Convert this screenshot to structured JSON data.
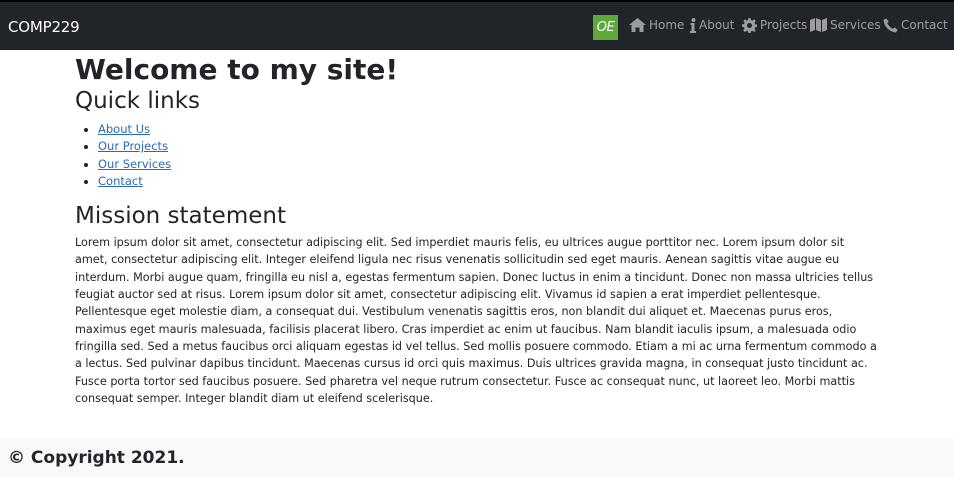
{
  "navbar": {
    "brand": "COMP229",
    "logo_text": "OE",
    "links": [
      {
        "label": "Home",
        "icon": "home-icon"
      },
      {
        "label": "About",
        "icon": "info-icon"
      },
      {
        "label": "Projects",
        "icon": "gear-icon"
      },
      {
        "label": "Services",
        "icon": "map-icon"
      },
      {
        "label": "Contact",
        "icon": "phone-icon"
      }
    ]
  },
  "main": {
    "title": "Welcome to my site!",
    "quick_links_heading": "Quick links",
    "quick_links": [
      "About Us",
      "Our Projects",
      "Our Services",
      "Contact"
    ],
    "mission_heading": "Mission statement",
    "mission_text": "Lorem ipsum dolor sit amet, consectetur adipiscing elit. Sed imperdiet mauris felis, eu ultrices augue porttitor nec. Lorem ipsum dolor sit amet, consectetur adipiscing elit. Integer eleifend ligula nec risus venenatis sollicitudin sed eget mauris. Aenean sagittis vitae augue eu interdum. Morbi augue quam, fringilla eu nisl a, egestas fermentum sapien. Donec luctus in enim a tincidunt. Donec non massa ultricies tellus feugiat auctor sed at risus. Lorem ipsum dolor sit amet, consectetur adipiscing elit. Vivamus id sapien a erat imperdiet pellentesque. Pellentesque eget molestie diam, a consequat dui. Vestibulum venenatis sagittis eros, non blandit dui aliquet et. Maecenas purus eros, maximus eget mauris malesuada, facilisis placerat libero. Cras imperdiet ac enim ut faucibus. Nam blandit iaculis ipsum, a malesuada odio fringilla sed. Sed a metus faucibus orci aliquam egestas id vel tellus. Sed mollis posuere commodo. Etiam a mi ac urna fermentum commodo a a lectus. Sed pulvinar dapibus tincidunt. Maecenas cursus id orci quis maximus. Duis ultrices gravida magna, in consequat justo tincidunt ac. Fusce porta tortor sed faucibus posuere. Sed pharetra vel neque rutrum consectetur. Fusce ac consequat nunc, ut laoreet leo. Morbi mattis consequat semper. Integer blandit diam ut eleifend scelerisque."
  },
  "footer": {
    "copyright": "© Copyright 2021."
  },
  "colors": {
    "navbar_bg": "#212529",
    "logo_bg": "#5fa83a",
    "link": "#2a6bb3",
    "footer_bg": "#f8f9fa"
  }
}
